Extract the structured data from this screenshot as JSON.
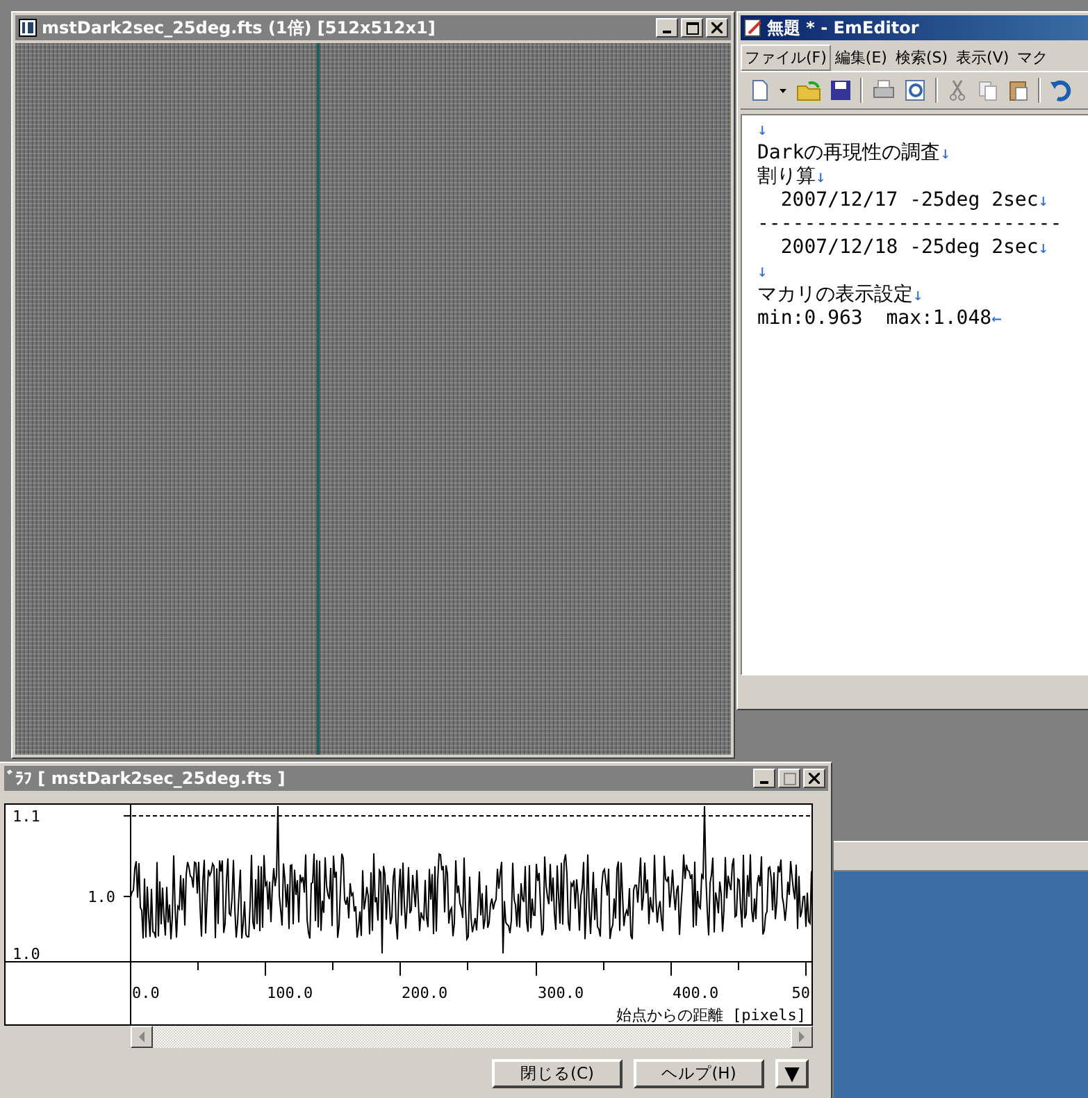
{
  "image_window": {
    "title": "mstDark2sec_25deg.fts (1倍) [512x512x1]",
    "active": false
  },
  "editor_window": {
    "title": "無題 * - EmEditor",
    "active": true,
    "menu": [
      {
        "label": "ファイル(F)",
        "selected": true
      },
      {
        "label": "編集(E)",
        "selected": false
      },
      {
        "label": "検索(S)",
        "selected": false
      },
      {
        "label": "表示(V)",
        "selected": false
      },
      {
        "label": "マク",
        "selected": false
      }
    ],
    "lines": [
      {
        "mark": "↓"
      },
      {
        "text": "Darkの再現性の調査",
        "mark": "↓"
      },
      {
        "text": "割り算",
        "mark": "↓"
      },
      {
        "text": "  2007/12/17 -25deg 2sec",
        "mark": "↓"
      },
      {
        "text": "--------------------------"
      },
      {
        "text": "  2007/12/18 -25deg 2sec",
        "mark": "↓"
      },
      {
        "mark": "↓"
      },
      {
        "text": "マカリの表示設定",
        "mark": "↓"
      },
      {
        "text": "min:0.963  max:1.048",
        "mark": "←"
      }
    ]
  },
  "graph_window": {
    "title": "ﾞﾗﾌ [ mstDark2sec_25deg.fts ]",
    "active": false,
    "y_labels": [
      "1.1",
      "1.0",
      "1.0"
    ],
    "x_ticks": [
      "0.0",
      "100.0",
      "200.0",
      "300.0",
      "400.0",
      "50"
    ],
    "x_label": "始点からの距離 [pixels]",
    "buttons": [
      "閉じる(C)",
      "ヘルプ(H)"
    ],
    "dropdown": "▼"
  }
}
